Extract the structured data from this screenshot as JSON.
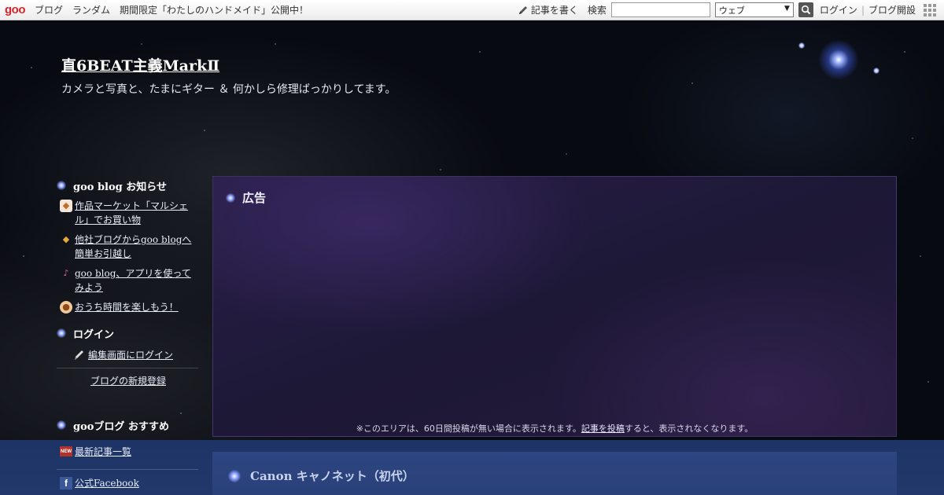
{
  "topbar": {
    "logo": "goo",
    "links": [
      "ブログ",
      "ランダム",
      "期間限定「わたしのハンドメイド」公開中！"
    ],
    "write_label": "記事を書く",
    "search_label": "検索",
    "search_value": "",
    "search_scope": "ウェブ",
    "login_label": "ログイン",
    "open_blog_label": "ブログ開設"
  },
  "header": {
    "title": "直6BEAT主義MarkⅡ",
    "description": "カメラと写真と、たまにギター ＆ 何かしら修理ばっかりしてます。"
  },
  "sidebar": {
    "notice_heading": "goo blog お知らせ",
    "notices": [
      {
        "label": "作品マーケット「マルシェル」でお買い物",
        "icon": "fox-icon"
      },
      {
        "label": "他社ブログからgoo blogへ簡単お引越し",
        "icon": "diamond-icon"
      },
      {
        "label": "goo blog、アプリを使ってみよう",
        "icon": "music-note-icon"
      },
      {
        "label": "おうち時間を楽しもう！",
        "icon": "dog-icon"
      }
    ],
    "login_heading": "ログイン",
    "login_edit_label": "編集画面にログイン",
    "register_label": "ブログの新規登録",
    "recommend_heading": "gooブログ おすすめ",
    "recommend_items": [
      {
        "label": "最新記事一覧",
        "icon": "new-icon",
        "badge": "NEW"
      },
      {
        "label": "公式Facebook",
        "icon": "facebook-icon",
        "badge": "f"
      }
    ]
  },
  "ad": {
    "heading": "広告",
    "note_before": "※このエリアは、60日間投稿が無い場合に表示されます。",
    "note_link": "記事を投稿",
    "note_after": "すると、表示されなくなります。"
  },
  "article": {
    "title": "Canon キャノネット（初代）"
  }
}
